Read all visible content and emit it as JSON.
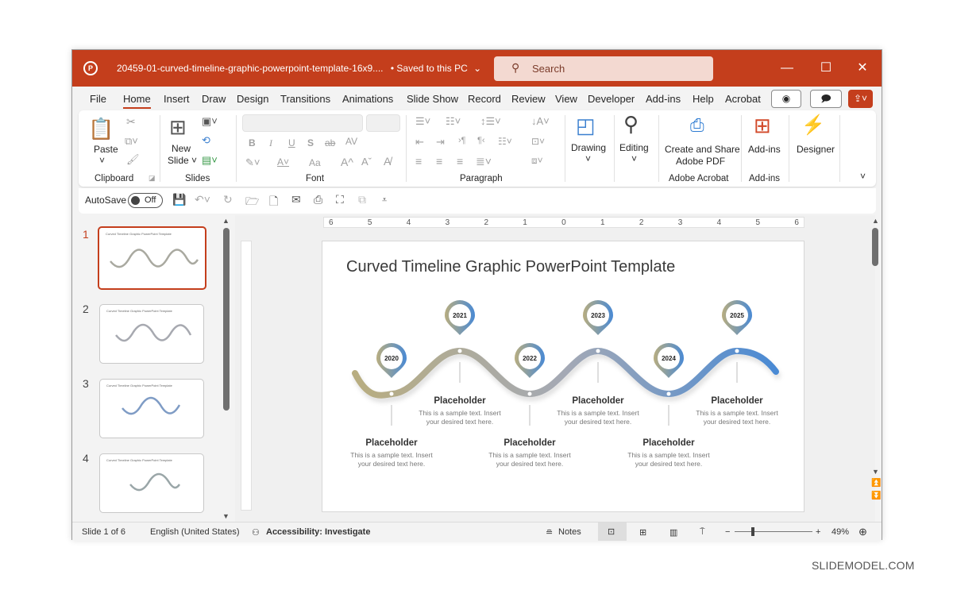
{
  "titlebar": {
    "app_icon": "powerpoint-logo-icon",
    "document_name": "20459-01-curved-timeline-graphic-powerpoint-template-16x9....",
    "save_status": "• Saved to this PC",
    "search_placeholder": "Search",
    "minimize": "—",
    "maximize": "☐",
    "close": "✕",
    "accent_color": "#c43e1c"
  },
  "tabs": [
    "File",
    "Home",
    "Insert",
    "Draw",
    "Design",
    "Transitions",
    "Animations",
    "Slide Show",
    "Record",
    "Review",
    "View",
    "Developer",
    "Add-ins",
    "Help",
    "Acrobat"
  ],
  "active_tab": "Home",
  "ribbon": {
    "clipboard": {
      "paste": "Paste",
      "label": "Clipboard"
    },
    "slides": {
      "new_slide_1": "New",
      "new_slide_2": "Slide ˅",
      "label": "Slides"
    },
    "font": {
      "label": "Font",
      "bold": "B",
      "italic": "I",
      "underline": "U",
      "shadow": "S",
      "strike": "ab",
      "spacing": "AV",
      "case": "Aa",
      "grow": "A^",
      "shrink": "Aˇ"
    },
    "paragraph": {
      "label": "Paragraph"
    },
    "drawing": "Drawing",
    "editing": "Editing",
    "acrobat": {
      "line1": "Create and Share",
      "line2": "Adobe PDF",
      "label": "Adobe Acrobat"
    },
    "addins": {
      "button": "Add-ins",
      "label": "Add-ins"
    },
    "designer": "Designer"
  },
  "qat": {
    "autosave": "AutoSave",
    "toggle": "Off"
  },
  "thumbnails": [
    {
      "num": "1",
      "title": "Curved Timeline Graphic PowerPoint Template",
      "selected": true
    },
    {
      "num": "2",
      "title": "Curved Timeline Graphic PowerPoint Template",
      "selected": false
    },
    {
      "num": "3",
      "title": "Curved Timeline Graphic PowerPoint Template",
      "selected": false
    },
    {
      "num": "4",
      "title": "Curved Timeline Graphic PowerPoint Template",
      "selected": false
    }
  ],
  "ruler": {
    "h_ticks": [
      "6",
      "5",
      "4",
      "3",
      "2",
      "1",
      "0",
      "1",
      "2",
      "3",
      "4",
      "5",
      "6"
    ]
  },
  "slide": {
    "title": "Curved Timeline Graphic PowerPoint Template",
    "milestones": [
      {
        "year": "2020",
        "heading": "Placeholder",
        "text": "This is a sample text. Insert your desired text here."
      },
      {
        "year": "2021",
        "heading": "Placeholder",
        "text": "This is a sample text. Insert your desired text here."
      },
      {
        "year": "2022",
        "heading": "Placeholder",
        "text": "This is a sample text. Insert your desired text here."
      },
      {
        "year": "2023",
        "heading": "Placeholder",
        "text": "This is a sample text. Insert your desired text here."
      },
      {
        "year": "2024",
        "heading": "Placeholder",
        "text": "This is a sample text. Insert your desired text here."
      },
      {
        "year": "2025",
        "heading": "Placeholder",
        "text": "This is a sample text. Insert your desired text here."
      }
    ],
    "gradient_start": "#b8ad80",
    "gradient_mid": "#a4a9b5",
    "gradient_end": "#4a8ad4"
  },
  "status": {
    "slide_counter": "Slide 1 of 6",
    "language": "English (United States)",
    "accessibility": "Accessibility: Investigate",
    "notes": "Notes",
    "zoom_minus": "−",
    "zoom_plus": "+",
    "zoom_level": "49%"
  },
  "watermark": "SLIDEMODEL.COM"
}
